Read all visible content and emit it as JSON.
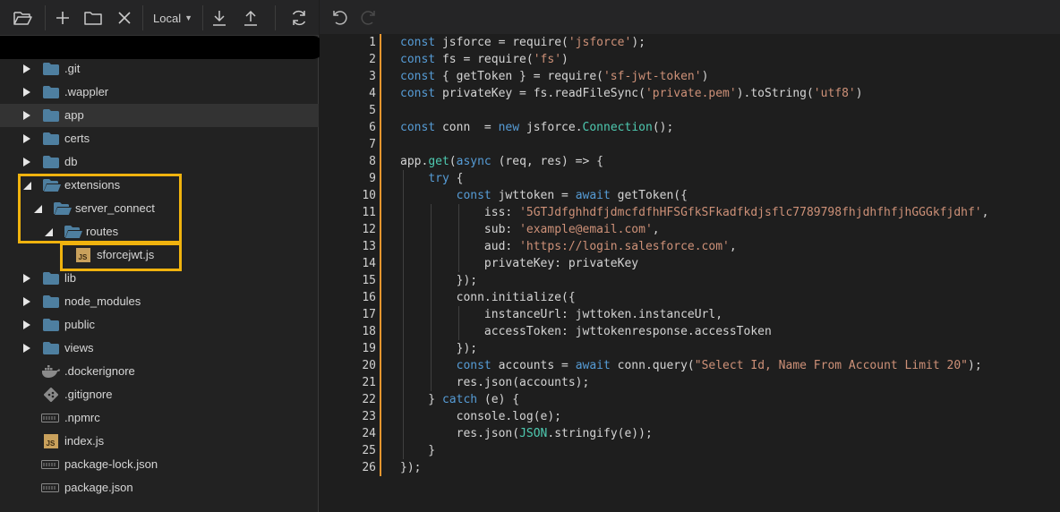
{
  "toolbar": {
    "location_label": "Local"
  },
  "tree": [
    {
      "label": ".git",
      "type": "folder",
      "expanded": false
    },
    {
      "label": ".wappler",
      "type": "folder",
      "expanded": false
    },
    {
      "label": "app",
      "type": "folder",
      "expanded": false,
      "selected": true
    },
    {
      "label": "certs",
      "type": "folder",
      "expanded": false
    },
    {
      "label": "db",
      "type": "folder",
      "expanded": false
    },
    {
      "label": "extensions",
      "type": "folder",
      "expanded": true
    },
    {
      "label": "server_connect",
      "type": "folder",
      "expanded": true
    },
    {
      "label": "routes",
      "type": "folder",
      "expanded": true
    },
    {
      "label": "sforcejwt.js",
      "type": "js"
    },
    {
      "label": "lib",
      "type": "folder",
      "expanded": false
    },
    {
      "label": "node_modules",
      "type": "folder",
      "expanded": false
    },
    {
      "label": "public",
      "type": "folder",
      "expanded": false
    },
    {
      "label": "views",
      "type": "folder",
      "expanded": false
    },
    {
      "label": ".dockerignore",
      "type": "docker"
    },
    {
      "label": ".gitignore",
      "type": "git"
    },
    {
      "label": ".npmrc",
      "type": "generic"
    },
    {
      "label": "index.js",
      "type": "js"
    },
    {
      "label": "package-lock.json",
      "type": "generic"
    },
    {
      "label": "package.json",
      "type": "generic"
    }
  ],
  "editor": {
    "lines": [
      [
        [
          "k",
          "const"
        ],
        [
          "p",
          " jsforce = require("
        ],
        [
          "s",
          "'jsforce'"
        ],
        [
          "p",
          ");"
        ]
      ],
      [
        [
          "k",
          "const"
        ],
        [
          "p",
          " fs = require("
        ],
        [
          "s",
          "'fs'"
        ],
        [
          "p",
          ")"
        ]
      ],
      [
        [
          "k",
          "const"
        ],
        [
          "p",
          " { getToken } = require("
        ],
        [
          "s",
          "'sf-jwt-token'"
        ],
        [
          "p",
          ")"
        ]
      ],
      [
        [
          "k",
          "const"
        ],
        [
          "p",
          " privateKey = fs.readFileSync("
        ],
        [
          "s",
          "'private.pem'"
        ],
        [
          "p",
          ").toString("
        ],
        [
          "s",
          "'utf8'"
        ],
        [
          "p",
          ")"
        ]
      ],
      [],
      [
        [
          "k",
          "const"
        ],
        [
          "p",
          " conn  = "
        ],
        [
          "k",
          "new"
        ],
        [
          "p",
          " jsforce."
        ],
        [
          "t",
          "Connection"
        ],
        [
          "p",
          "();"
        ]
      ],
      [],
      [
        [
          "p",
          "app."
        ],
        [
          "t",
          "get"
        ],
        [
          "p",
          "("
        ],
        [
          "k",
          "async"
        ],
        [
          "p",
          " (req, res) => {"
        ]
      ],
      [
        [
          "p",
          "    "
        ],
        [
          "k",
          "try"
        ],
        [
          "p",
          " {"
        ]
      ],
      [
        [
          "p",
          "        "
        ],
        [
          "k",
          "const"
        ],
        [
          "p",
          " jwttoken = "
        ],
        [
          "k",
          "await"
        ],
        [
          "p",
          " getToken({"
        ]
      ],
      [
        [
          "p",
          "            iss: "
        ],
        [
          "s",
          "'5GTJdfghhdfjdmcfdfhHFSGfkSFkadfkdjsflc7789798fhjdhfhfjhGGGkfjdhf'"
        ],
        [
          "p",
          ","
        ]
      ],
      [
        [
          "p",
          "            sub: "
        ],
        [
          "s",
          "'example@email.com'"
        ],
        [
          "p",
          ","
        ]
      ],
      [
        [
          "p",
          "            aud: "
        ],
        [
          "s",
          "'https://login.salesforce.com'"
        ],
        [
          "p",
          ","
        ]
      ],
      [
        [
          "p",
          "            privateKey: privateKey"
        ]
      ],
      [
        [
          "p",
          "        });"
        ]
      ],
      [
        [
          "p",
          "        conn.initialize({"
        ]
      ],
      [
        [
          "p",
          "            instanceUrl: jwttoken.instanceUrl,"
        ]
      ],
      [
        [
          "p",
          "            accessToken: jwttokenresponse.accessToken"
        ]
      ],
      [
        [
          "p",
          "        });"
        ]
      ],
      [
        [
          "p",
          "        "
        ],
        [
          "k",
          "const"
        ],
        [
          "p",
          " accounts = "
        ],
        [
          "k",
          "await"
        ],
        [
          "p",
          " conn.query("
        ],
        [
          "s",
          "\"Select Id, Name From Account Limit 20\""
        ],
        [
          "p",
          ");"
        ]
      ],
      [
        [
          "p",
          "        res.json(accounts);"
        ]
      ],
      [
        [
          "p",
          "    } "
        ],
        [
          "k",
          "catch"
        ],
        [
          "p",
          " (e) {"
        ]
      ],
      [
        [
          "p",
          "        console.log(e);"
        ]
      ],
      [
        [
          "p",
          "        res.json("
        ],
        [
          "t",
          "JSON"
        ],
        [
          "p",
          ".stringify(e));"
        ]
      ],
      [
        [
          "p",
          "    }"
        ]
      ],
      [
        [
          "p",
          "});"
        ]
      ]
    ]
  },
  "colors": {
    "folder": "#4e7fa0",
    "highlight": "#f0b30e",
    "gutter_accent": "#e8962f",
    "keyword": "#569cd6",
    "string": "#ce9178",
    "type": "#4ec9b0"
  }
}
